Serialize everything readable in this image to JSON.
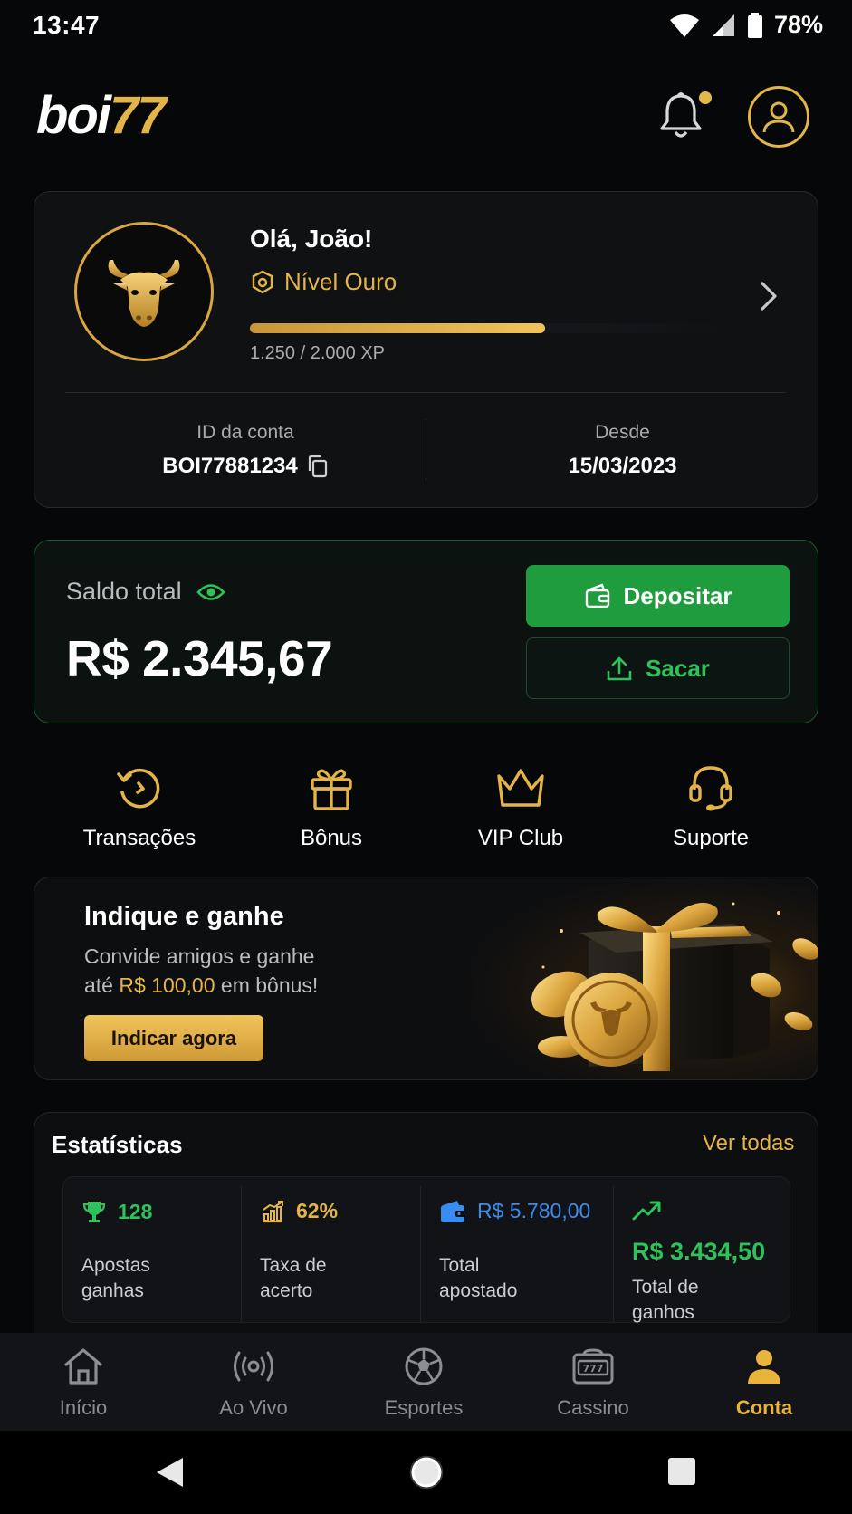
{
  "status_bar": {
    "time": "13:47",
    "battery": "78%"
  },
  "header": {
    "logo_text": "boi",
    "logo_number": "77"
  },
  "profile": {
    "greeting": "Olá, João!",
    "level": "Nível Ouro",
    "xp_text": "1.250 / 2.000 XP",
    "xp_progress": 0.625,
    "account_id_label": "ID da conta",
    "account_id": "BOI77881234",
    "since_label": "Desde",
    "since_date": "15/03/2023"
  },
  "balance": {
    "label": "Saldo total",
    "value": "R$ 2.345,67",
    "deposit_label": "Depositar",
    "withdraw_label": "Sacar"
  },
  "quick_actions": [
    {
      "label": "Transações",
      "icon": "history-icon"
    },
    {
      "label": "Bônus",
      "icon": "gift-icon"
    },
    {
      "label": "VIP Club",
      "icon": "crown-icon"
    },
    {
      "label": "Suporte",
      "icon": "headset-icon"
    }
  ],
  "referral": {
    "title": "Indique e ganhe",
    "desc_line1": "Convide amigos e ganhe",
    "desc_prefix": "até ",
    "desc_amount": "R$ 100,00",
    "desc_suffix": " em bônus!",
    "button": "Indicar agora"
  },
  "stats": {
    "title": "Estatísticas",
    "link": "Ver todas",
    "items": [
      {
        "value": "128",
        "label_l1": "Apostas",
        "label_l2": "ganhas",
        "icon": "trophy-icon",
        "color": "#2ec25a"
      },
      {
        "value": "62%",
        "label_l1": "Taxa de",
        "label_l2": "acerto",
        "icon": "chart-icon",
        "color": "#e3b448"
      },
      {
        "value": "R$ 5.780,00",
        "label_l1": "Total",
        "label_l2": "apostado",
        "icon": "wallet-icon",
        "color": "#3b8cf0"
      },
      {
        "value": "R$ 3.434,50",
        "label_l1": "Total de",
        "label_l2": "ganhos",
        "icon": "trend-up-icon",
        "color": "#2ec25a"
      }
    ]
  },
  "bottom_nav": [
    {
      "label": "Início",
      "icon": "home-icon"
    },
    {
      "label": "Ao Vivo",
      "icon": "live-icon"
    },
    {
      "label": "Esportes",
      "icon": "soccer-ball-icon"
    },
    {
      "label": "Cassino",
      "icon": "slot-machine-icon"
    },
    {
      "label": "Conta",
      "icon": "user-icon",
      "active": true
    }
  ],
  "colors": {
    "gold": "#e3b448",
    "green": "#1f9d3e",
    "background": "#060708"
  }
}
